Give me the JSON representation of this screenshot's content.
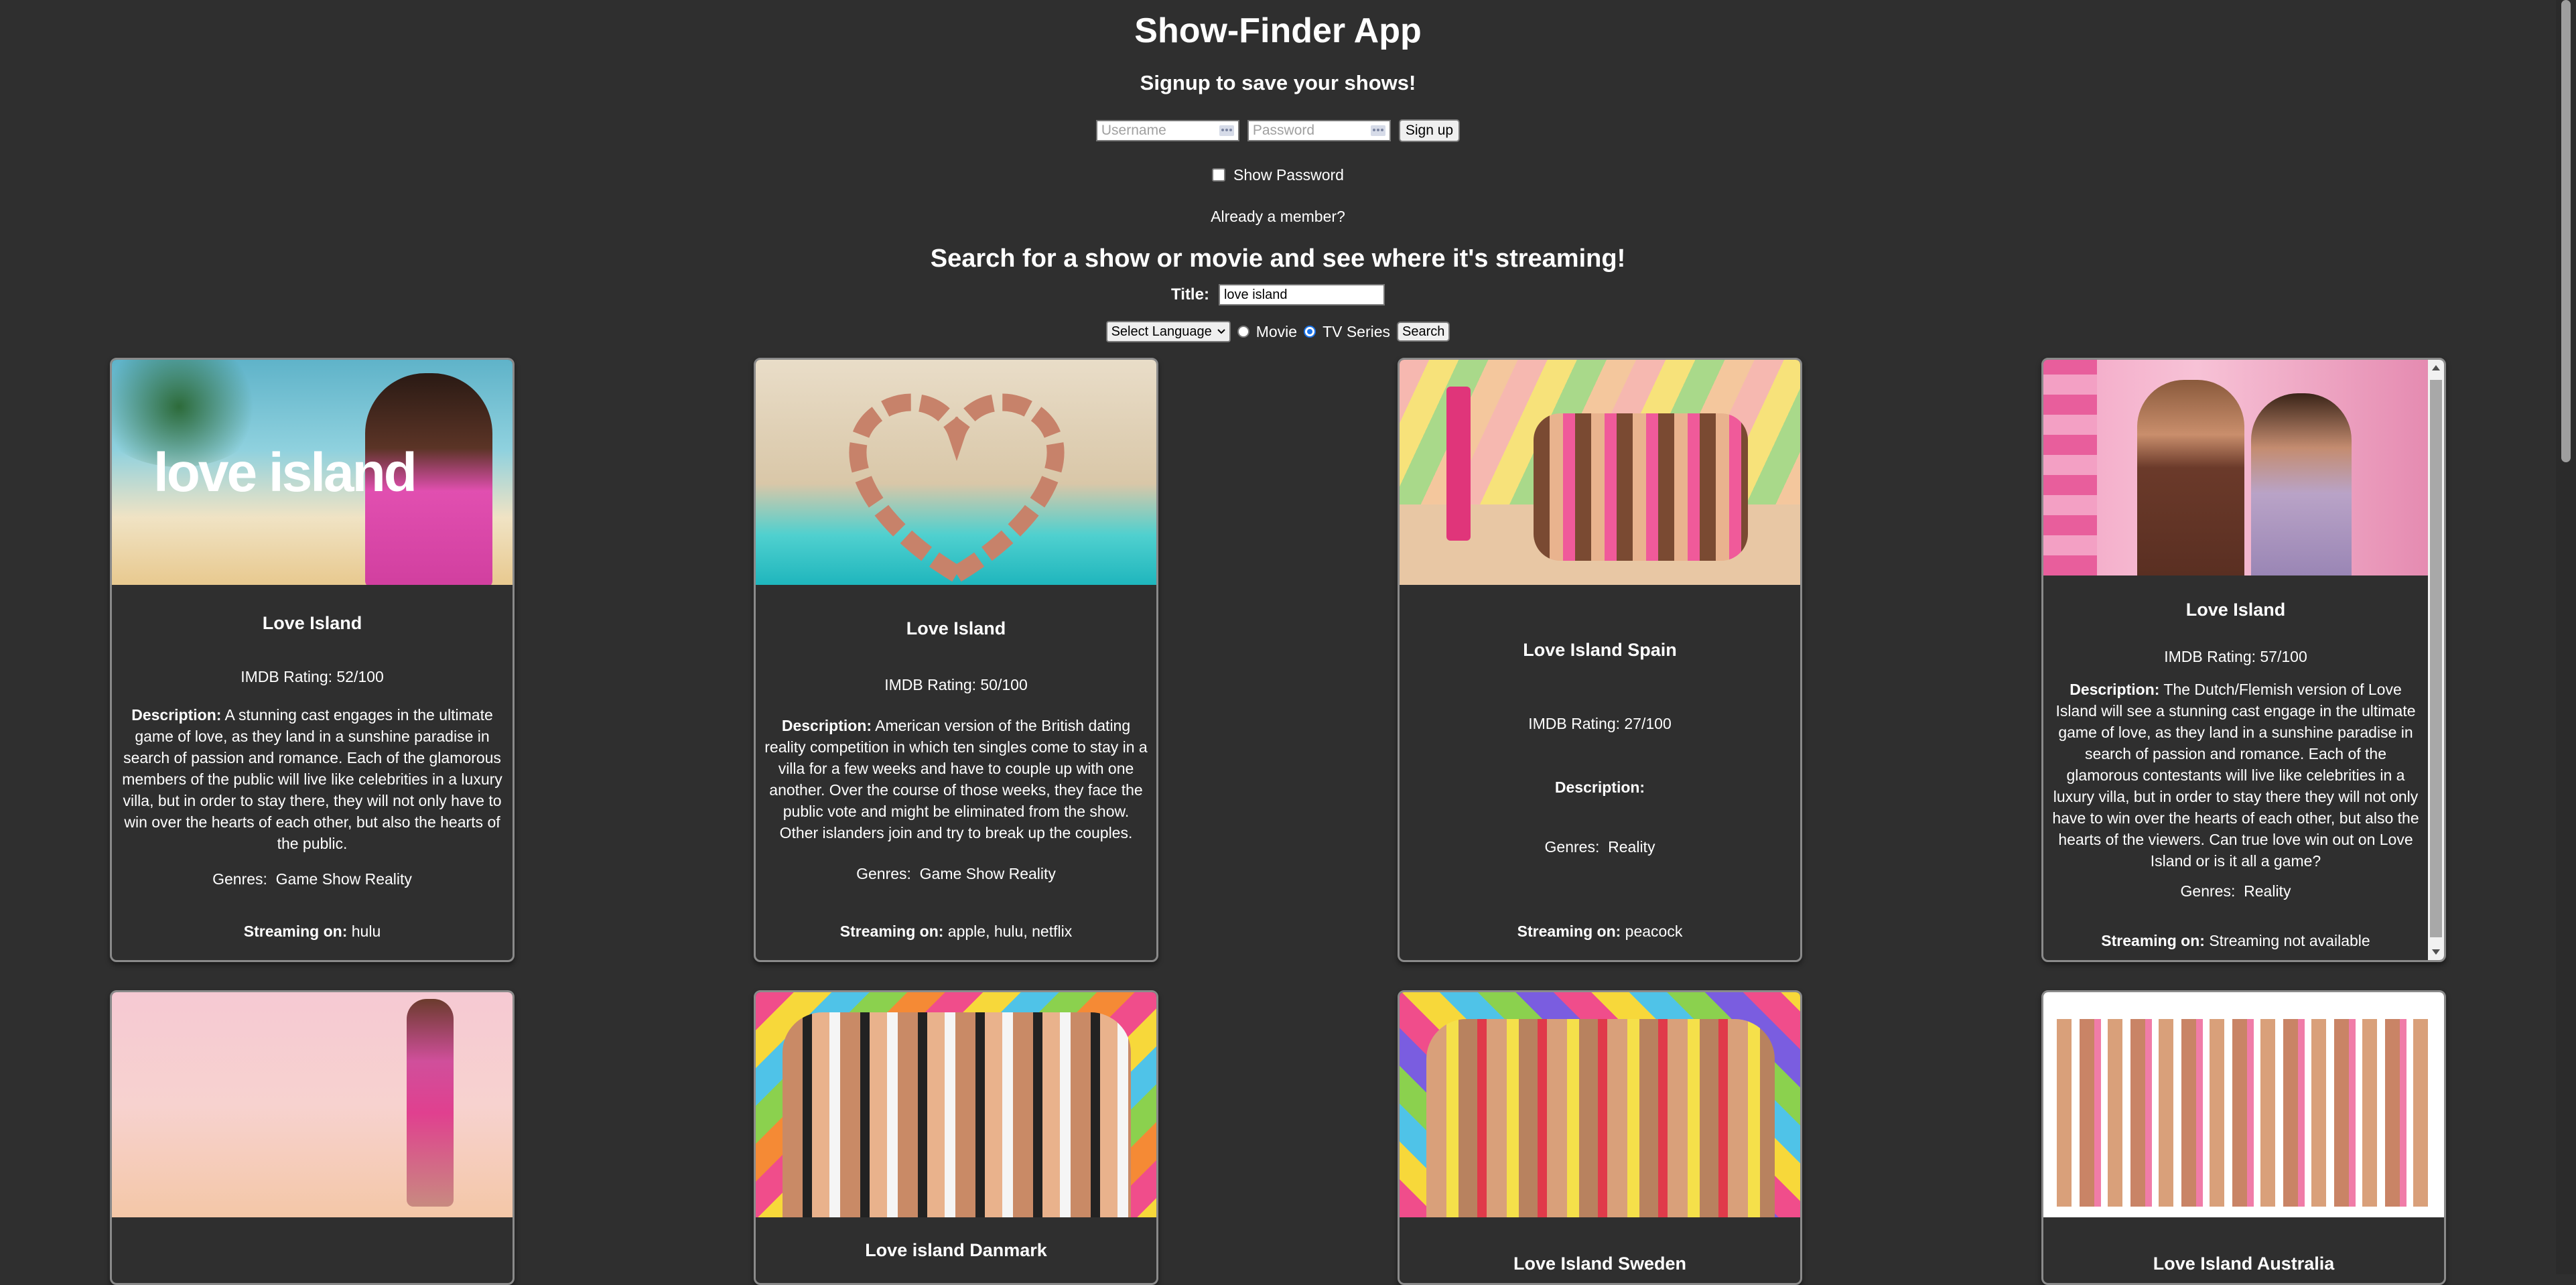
{
  "app": {
    "title": "Show-Finder App",
    "signup_heading": "Signup to save your shows!",
    "username_placeholder": "Username",
    "password_placeholder": "Password",
    "signup_button": "Sign up",
    "show_password_label": "Show Password",
    "member_link": "Already a member?"
  },
  "search": {
    "heading": "Search for a show or movie and see where it's streaming!",
    "title_label": "Title:",
    "title_value": "love island",
    "language_select": "Select Language",
    "movie_label": "Movie",
    "tv_label": "TV Series",
    "tv_selected": true,
    "search_button": "Search"
  },
  "labels": {
    "description": "Description:",
    "genres": "Genres:",
    "streaming": "Streaming on:"
  },
  "cards": [
    {
      "title": "Love Island",
      "rating": "IMDB Rating: 52/100",
      "description": "A stunning cast engages in the ultimate game of love, as they land in a sunshine paradise in search of passion and romance. Each of the glamorous members of the public will live like celebrities in a luxury villa, but in order to stay there, they will not only have to win over the hearts of each other, but also the hearts of the public.",
      "genres": "Game Show Reality",
      "streaming": "hulu",
      "poster_text": "love island"
    },
    {
      "title": "Love Island",
      "rating": "IMDB Rating: 50/100",
      "description": "American version of the British dating reality competition in which ten singles come to stay in a villa for a few weeks and have to couple up with one another. Over the course of those weeks, they face the public vote and might be eliminated from the show. Other islanders join and try to break up the couples.",
      "genres": "Game Show Reality",
      "streaming": "apple, hulu, netflix"
    },
    {
      "title": "Love Island Spain",
      "rating": "IMDB Rating: 27/100",
      "description": "",
      "genres": "Reality",
      "streaming": "peacock"
    },
    {
      "title": "Love Island",
      "rating": "IMDB Rating: 57/100",
      "description": "The Dutch/Flemish version of Love Island will see a stunning cast engage in the ultimate game of love, as they land in a sunshine paradise in search of passion and romance. Each of the glamorous contestants will live like celebrities in a luxury villa, but in order to stay there they will not only have to win over the hearts of each other, but also the hearts of the viewers. Can true love win out on Love Island or is it all a game?",
      "genres": "Reality",
      "streaming": "Streaming not available"
    },
    {
      "title": ""
    },
    {
      "title": "Love island Danmark"
    },
    {
      "title": "Love Island Sweden"
    },
    {
      "title": "Love Island Australia"
    }
  ]
}
